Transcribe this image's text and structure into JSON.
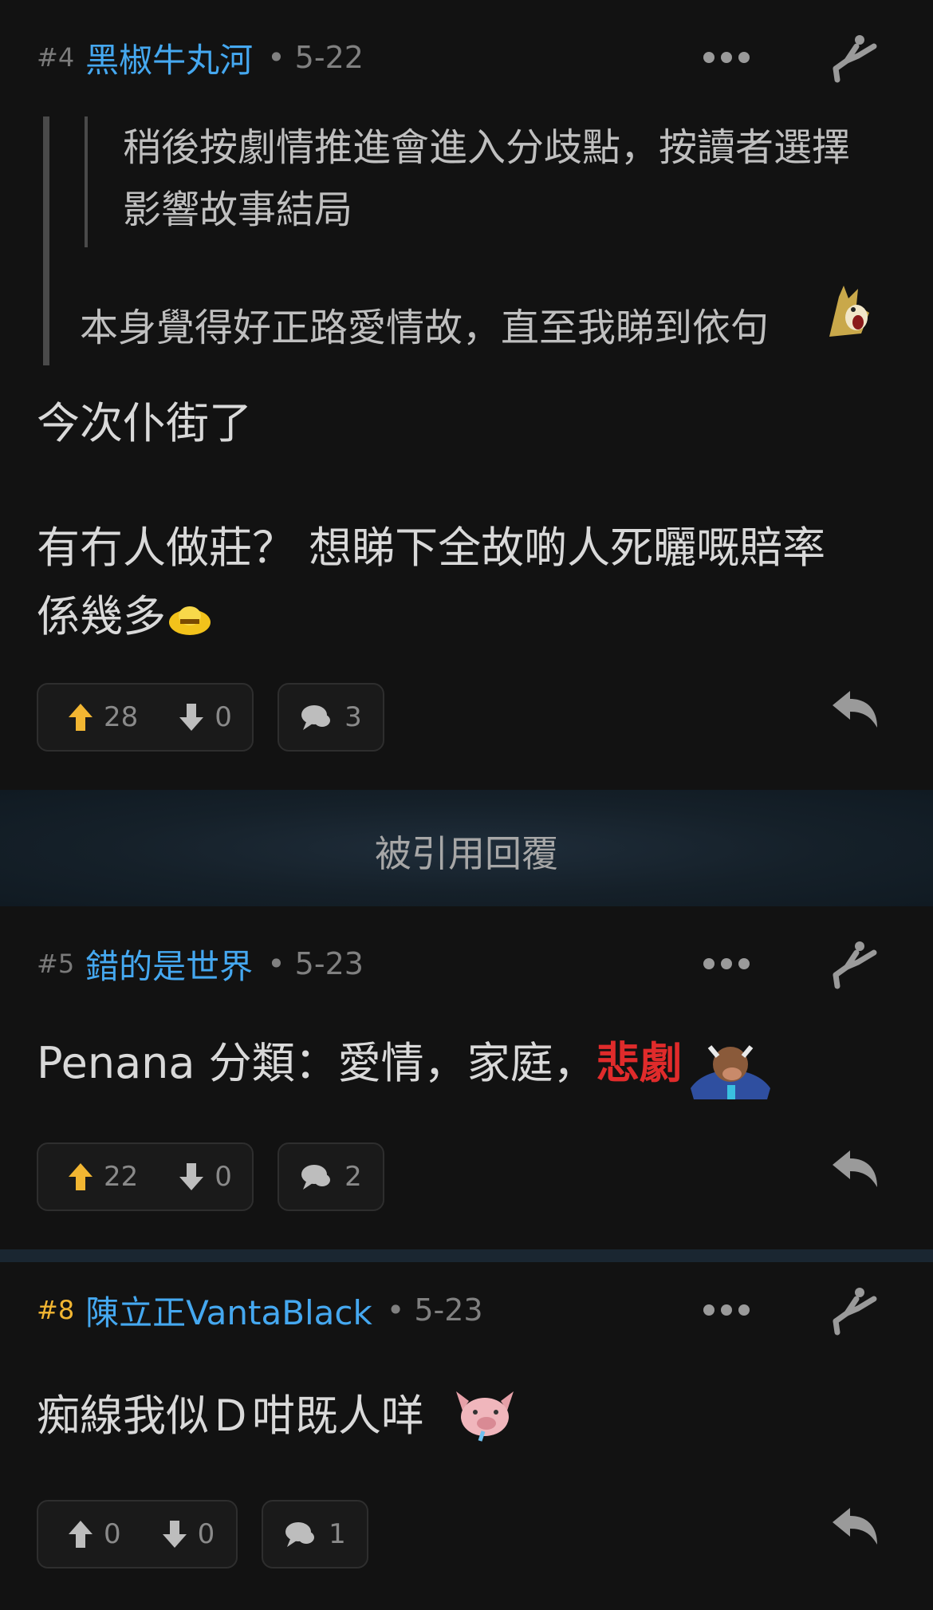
{
  "posts": [
    {
      "number": "#4",
      "username": "黑椒牛丸河",
      "date": "• 5-22",
      "quote_nested": [
        "稍後按劇情推進會進入分歧點，按讀者選擇",
        "影響故事結局"
      ],
      "quote_text": "本身覺得好正路愛情故，直至我睇到依句",
      "body": [
        "今次仆街了",
        "有冇人做莊？ 想睇下全故啲人死曬嘅賠率",
        "係幾多"
      ],
      "upvotes": "28",
      "downvotes": "0",
      "comments": "3",
      "upvote_color": "#f2b632"
    },
    {
      "number": "#5",
      "username": "錯的是世界",
      "date": "• 5-23",
      "body_prefix": "Penana 分類：愛情，家庭，",
      "body_red": "悲劇",
      "upvotes": "22",
      "downvotes": "0",
      "comments": "2",
      "upvote_color": "#f2b632"
    },
    {
      "number": "#8",
      "username": "陳立正VantaBlack",
      "date": "• 5-23",
      "body": "痴線我似Ｄ咁既人咩",
      "upvotes": "0",
      "downvotes": "0",
      "comments": "1",
      "upvote_color": "#bdbdbd",
      "number_color": "#f2b632"
    }
  ],
  "quoted_banner": "被引用回覆",
  "colors": {
    "background": "#121212",
    "username": "#45a8f0",
    "accent_gold": "#f2b632",
    "tag_red": "#e02b2b",
    "banner": "#1a2631"
  },
  "icons": [
    "more-dots-icon",
    "fly-icon",
    "upvote-arrow-icon",
    "downvote-arrow-icon",
    "comment-bubble-icon",
    "reply-arrow-icon"
  ]
}
